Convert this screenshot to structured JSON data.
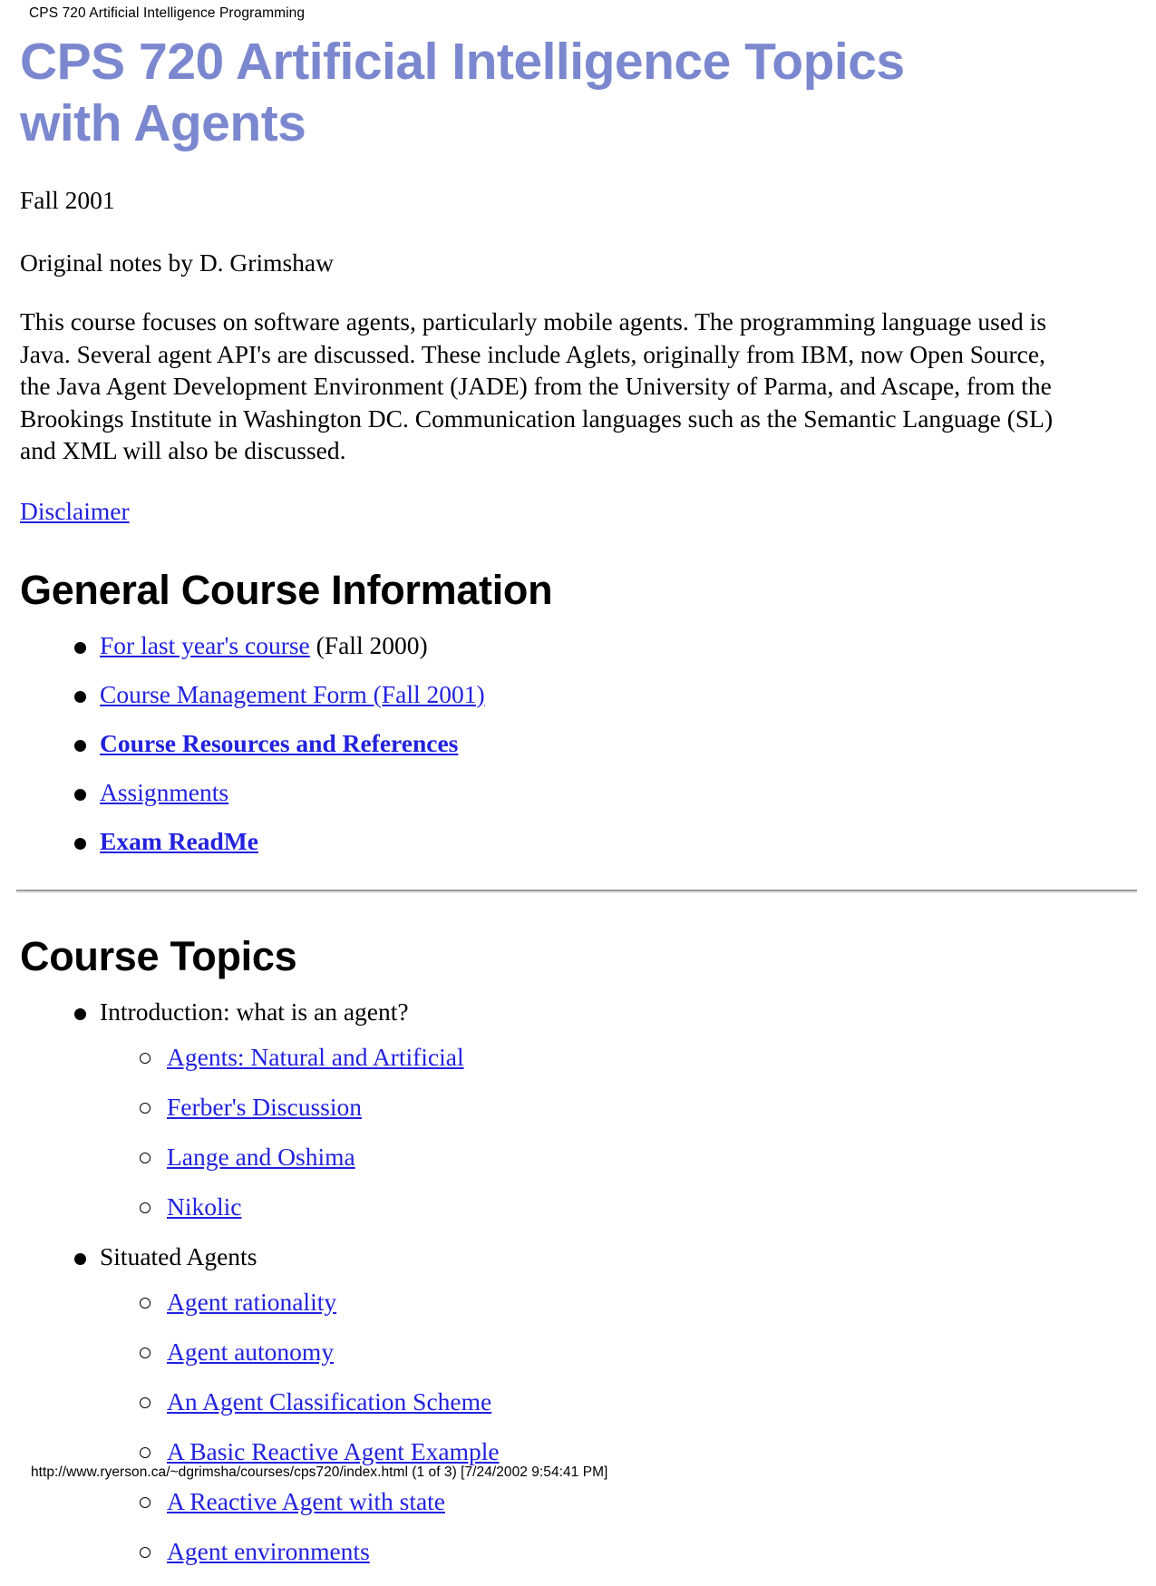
{
  "print_header": {
    "text": "CPS 720 Artificial Intelligence Programming"
  },
  "title": "CPS 720 Artificial Intelligence Topics with Agents",
  "meta": {
    "term": "Fall 2001",
    "credit": "Original notes by D. Grimshaw"
  },
  "intro_paragraph": "This course focuses on software agents, particularly mobile agents. The programming language used is Java. Several agent API's are discussed. These include Aglets, originally from IBM, now Open Source, the Java Agent Development Environment (JADE) from the University of Parma, and Ascape, from the Brookings Institute in Washington DC. Communication languages such as the Semantic Language (SL) and XML will also be discussed.",
  "disclaimer_link": "Disclaimer",
  "sections": {
    "general": {
      "heading": "General Course Information",
      "items": [
        {
          "link": "For last year's course",
          "suffix": " (Fall 2000)",
          "bold": false
        },
        {
          "link": "Course Management Form (Fall 2001)",
          "suffix": "",
          "bold": false
        },
        {
          "link": "Course Resources and References",
          "suffix": "",
          "bold": true
        },
        {
          "link": "Assignments",
          "suffix": "",
          "bold": false
        },
        {
          "link": "Exam ReadMe",
          "suffix": "",
          "bold": true
        }
      ]
    },
    "topics": {
      "heading": "Course Topics",
      "groups": [
        {
          "label": "Introduction: what is an agent?",
          "sub": [
            "Agents: Natural and Artificial",
            "Ferber's Discussion",
            "Lange and Oshima",
            "Nikolic"
          ]
        },
        {
          "label": "Situated Agents",
          "sub": [
            "Agent rationality",
            "Agent autonomy",
            "An Agent Classification Scheme",
            "A Basic Reactive Agent Example",
            "A Reactive Agent with state",
            "Agent environments"
          ]
        }
      ]
    }
  },
  "print_footer": {
    "text": "http://www.ryerson.ca/~dgrimsha/courses/cps720/index.html (1 of 3) [7/24/2002 9:54:41 PM]"
  },
  "colors": {
    "title": "#7b87ce",
    "link": "#2222dd",
    "text": "#000000",
    "background": "#ffffff"
  }
}
